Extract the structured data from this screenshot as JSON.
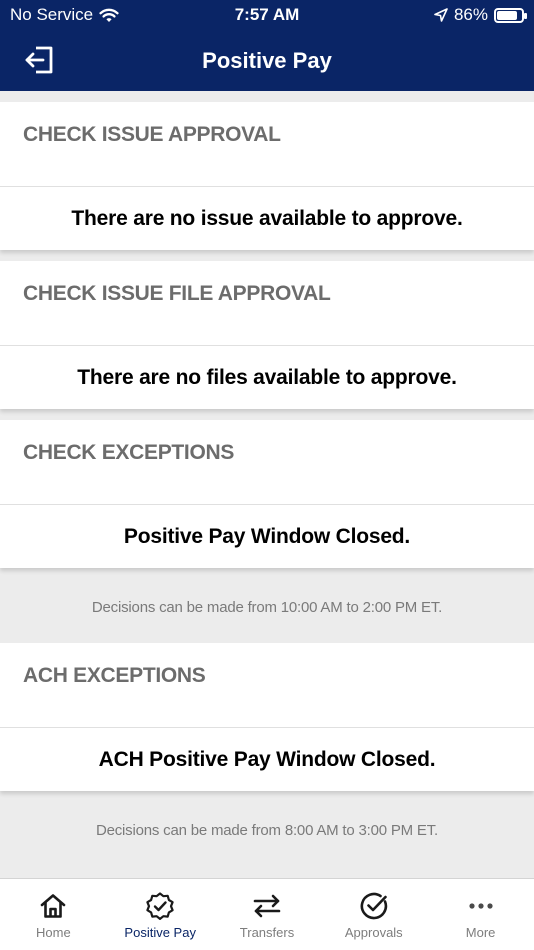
{
  "status_bar": {
    "carrier": "No Service",
    "time": "7:57 AM",
    "battery_text": "86%",
    "battery_level": 0.86
  },
  "nav": {
    "title": "Positive Pay"
  },
  "sections": [
    {
      "header": "CHECK ISSUE APPROVAL",
      "message": "There are no issue available to approve."
    },
    {
      "header": "CHECK ISSUE FILE APPROVAL",
      "message": "There are no files available to approve."
    },
    {
      "header": "CHECK EXCEPTIONS",
      "message": "Positive Pay Window Closed.",
      "note": "Decisions can be made from 10:00 AM to 2:00 PM ET."
    },
    {
      "header": "ACH EXCEPTIONS",
      "message": "ACH Positive Pay Window Closed.",
      "note": "Decisions can be made from 8:00 AM to 3:00 PM ET."
    }
  ],
  "tabs": [
    {
      "label": "Home",
      "icon": "home-icon"
    },
    {
      "label": "Positive Pay",
      "icon": "badge-check-icon",
      "active": true
    },
    {
      "label": "Transfers",
      "icon": "transfer-arrows-icon"
    },
    {
      "label": "Approvals",
      "icon": "check-circle-icon"
    },
    {
      "label": "More",
      "icon": "more-dots-icon"
    }
  ],
  "colors": {
    "brand_navy": "#0a2566",
    "section_header": "#6c6c6c",
    "background_gray": "#ececec",
    "tab_inactive": "#7d7d7d"
  }
}
